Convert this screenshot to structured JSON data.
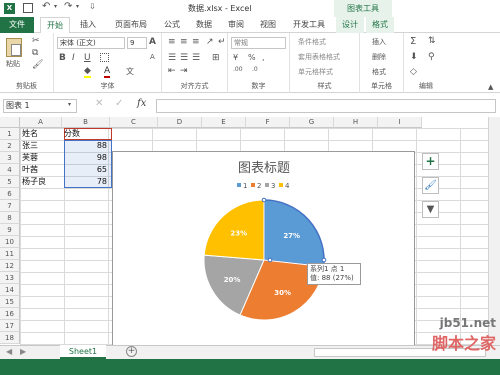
{
  "window": {
    "title": "数据.xlsx - Excel",
    "context_tab_header": "图表工具"
  },
  "tabs": {
    "file": "文件",
    "home": "开始",
    "insert": "插入",
    "page_layout": "页面布局",
    "formulas": "公式",
    "data": "数据",
    "review": "审阅",
    "view": "视图",
    "developer": "开发工具",
    "design": "设计",
    "format": "格式"
  },
  "ribbon": {
    "clipboard": {
      "label": "剪贴板",
      "paste": "粘贴"
    },
    "font": {
      "label": "字体",
      "name": "宋体 (正文)",
      "size": "9",
      "bold": "B",
      "italic": "I",
      "underline": "U",
      "grow": "A",
      "shrink": "A",
      "color_letter": "A",
      "bg_letter": "文"
    },
    "alignment": {
      "label": "对齐方式"
    },
    "number": {
      "label": "数字",
      "format": "常规",
      "percent": "%",
      "comma": ",",
      "dec_inc": ".00",
      "dec_dec": ".0"
    },
    "styles": {
      "label": "样式",
      "conditional": "条件格式",
      "table_format": "套用表格格式",
      "cell_styles": "单元格样式"
    },
    "cells": {
      "label": "单元格",
      "insert": "插入",
      "delete": "删除",
      "format": "格式"
    },
    "editing": {
      "label": "编辑"
    }
  },
  "formula_bar": {
    "name_box": "图表 1",
    "fx": "fx",
    "formula": ""
  },
  "columns": [
    "A",
    "B",
    "C",
    "D",
    "E",
    "F",
    "G",
    "H",
    "I"
  ],
  "rows": [
    "1",
    "2",
    "3",
    "4",
    "5",
    "6",
    "7",
    "8",
    "9",
    "10",
    "11",
    "12",
    "13",
    "14",
    "15",
    "16",
    "17",
    "18",
    "19",
    "20"
  ],
  "table": {
    "headers": [
      "姓名",
      "分数"
    ],
    "data": [
      {
        "name": "张三",
        "score": "88"
      },
      {
        "name": "芙蓉",
        "score": "98"
      },
      {
        "name": "叶茜",
        "score": "65"
      },
      {
        "name": "杨子良",
        "score": "78"
      }
    ]
  },
  "chart_data": {
    "type": "pie",
    "title": "图表标题",
    "categories": [
      "1",
      "2",
      "3",
      "4"
    ],
    "values": [
      88,
      98,
      65,
      78
    ],
    "slice_labels": [
      "27%",
      "30%",
      "20%",
      "23%"
    ],
    "colors": [
      "#5b9bd5",
      "#ed7d31",
      "#a5a5a5",
      "#ffc000"
    ],
    "legend_position": "top",
    "tooltip": {
      "line1": "系列1 点 1",
      "line2": "值: 88 (27%)"
    }
  },
  "sheet_tabs": {
    "active": "Sheet1",
    "add": "+"
  },
  "watermark": {
    "site": "jb51.net",
    "name": "脚本之家"
  },
  "colors": {
    "excel_green": "#217346",
    "context_green": "#e7f3ea"
  }
}
